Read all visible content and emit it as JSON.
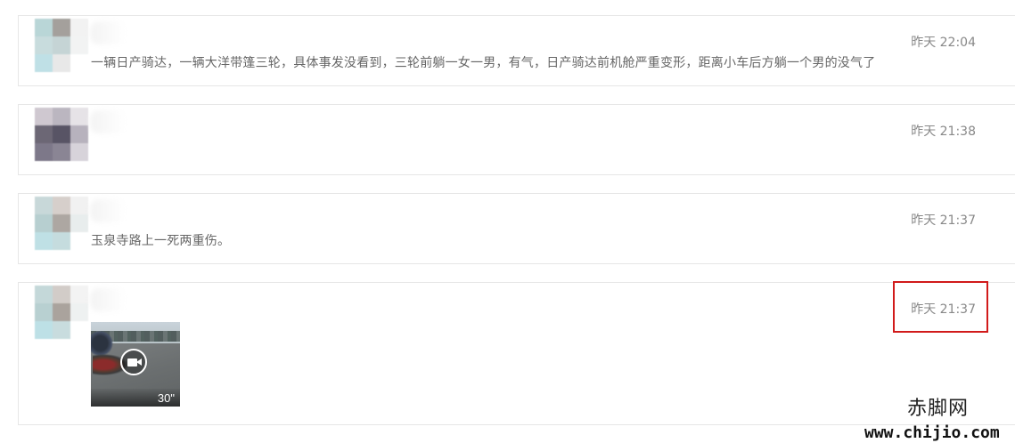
{
  "posts": [
    {
      "time": "昨天 22:04",
      "text": "一辆日产骑达，一辆大洋带篷三轮，具体事发没看到，三轮前躺一女一男，有气，日产骑达前机舱严重变形，距离小车后方躺一个男的没气了",
      "avatar_colors": [
        "#b9d6d7",
        "#a4a09c",
        "#f2f2f2",
        "#c8dcdd",
        "#c5d4d5",
        "#f2f3f3",
        "#bfe0e6",
        "#e8e8e8",
        "#ffffff"
      ]
    },
    {
      "time": "昨天 21:38",
      "text": "",
      "avatar_colors": [
        "#cfc8d0",
        "#bbb6c0",
        "#e6e3e7",
        "#6c6775",
        "#585465",
        "#b7b2bd",
        "#7d7889",
        "#8a8594",
        "#d7d3da"
      ]
    },
    {
      "time": "昨天 21:37",
      "text": "玉泉寺路上一死两重伤。",
      "avatar_colors": [
        "#c8d8d9",
        "#d6cfcb",
        "#f1f1f1",
        "#b7cfd0",
        "#ada7a2",
        "#e8eded",
        "#bfe0e5",
        "#c5dcde",
        "#ffffff"
      ]
    },
    {
      "time": "昨天 21:37",
      "text": "",
      "video": {
        "duration": "30\""
      },
      "avatar_colors": [
        "#c4d8d9",
        "#d2ccc8",
        "#f3f3f3",
        "#b8d0d1",
        "#aaa39d",
        "#eef1f1",
        "#bde0e6",
        "#c8dcde",
        "#ffffff"
      ]
    }
  ],
  "watermark": {
    "name": "赤脚网",
    "url": "www.chijio.com"
  },
  "highlight_color": "#d11a1a"
}
